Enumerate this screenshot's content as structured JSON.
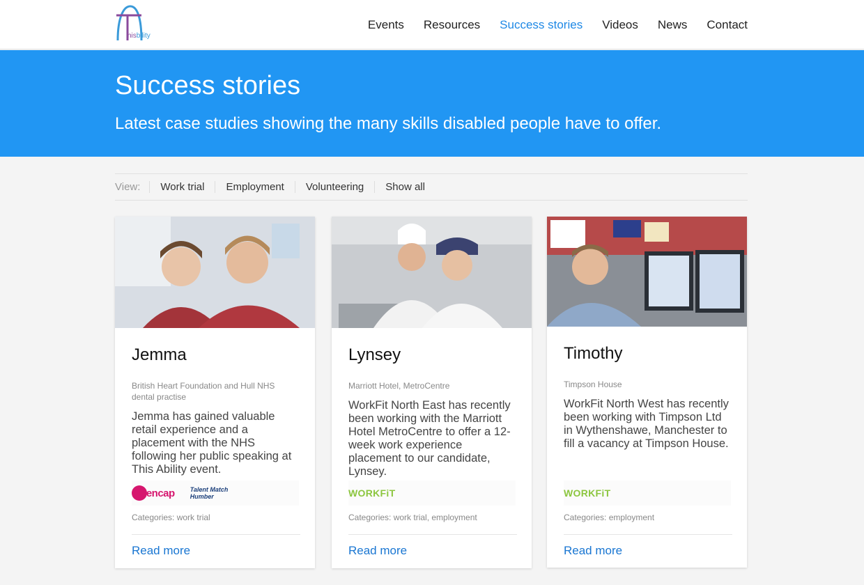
{
  "brand": {
    "logo_text_his": "his",
    "logo_text_bility": "bility"
  },
  "nav": [
    {
      "label": "Events",
      "active": false
    },
    {
      "label": "Resources",
      "active": false
    },
    {
      "label": "Success stories",
      "active": true
    },
    {
      "label": "Videos",
      "active": false
    },
    {
      "label": "News",
      "active": false
    },
    {
      "label": "Contact",
      "active": false
    }
  ],
  "hero": {
    "title": "Success stories",
    "subtitle": "Latest case studies showing the many skills disabled people have to offer."
  },
  "filter": {
    "label": "View:",
    "options": [
      "Work trial",
      "Employment",
      "Volunteering",
      "Show all"
    ]
  },
  "cards": [
    {
      "name": "Jemma",
      "org": "British Heart Foundation and Hull NHS dental practise",
      "desc": "Jemma has gained valuable retail experience and a placement with the NHS following her public speaking at This Ability event.",
      "logo1": "mencap",
      "logo2_line1": "Talent Match",
      "logo2_line2": "Humber",
      "categories": "Categories: work trial",
      "read_more": "Read more"
    },
    {
      "name": "Lynsey",
      "org": "Marriott Hotel, MetroCentre",
      "desc": "WorkFit North East has recently been working with the Marriott Hotel MetroCentre to offer a 12-week work experience placement to our candidate, Lynsey.",
      "logo1": "WORKFiT",
      "categories": "Categories: work trial, employment",
      "read_more": "Read more"
    },
    {
      "name": "Timothy",
      "org": "Timpson House",
      "desc": "WorkFit North West has recently been working with Timpson Ltd in Wythenshawe, Manchester to fill a vacancy at Timpson House.",
      "logo1": "WORKFiT",
      "categories": "Categories: employment",
      "read_more": "Read more"
    }
  ],
  "colors": {
    "accent": "#2196f3",
    "link": "#1976d2",
    "mencap": "#d6166e",
    "workfit": "#8cc63f"
  }
}
